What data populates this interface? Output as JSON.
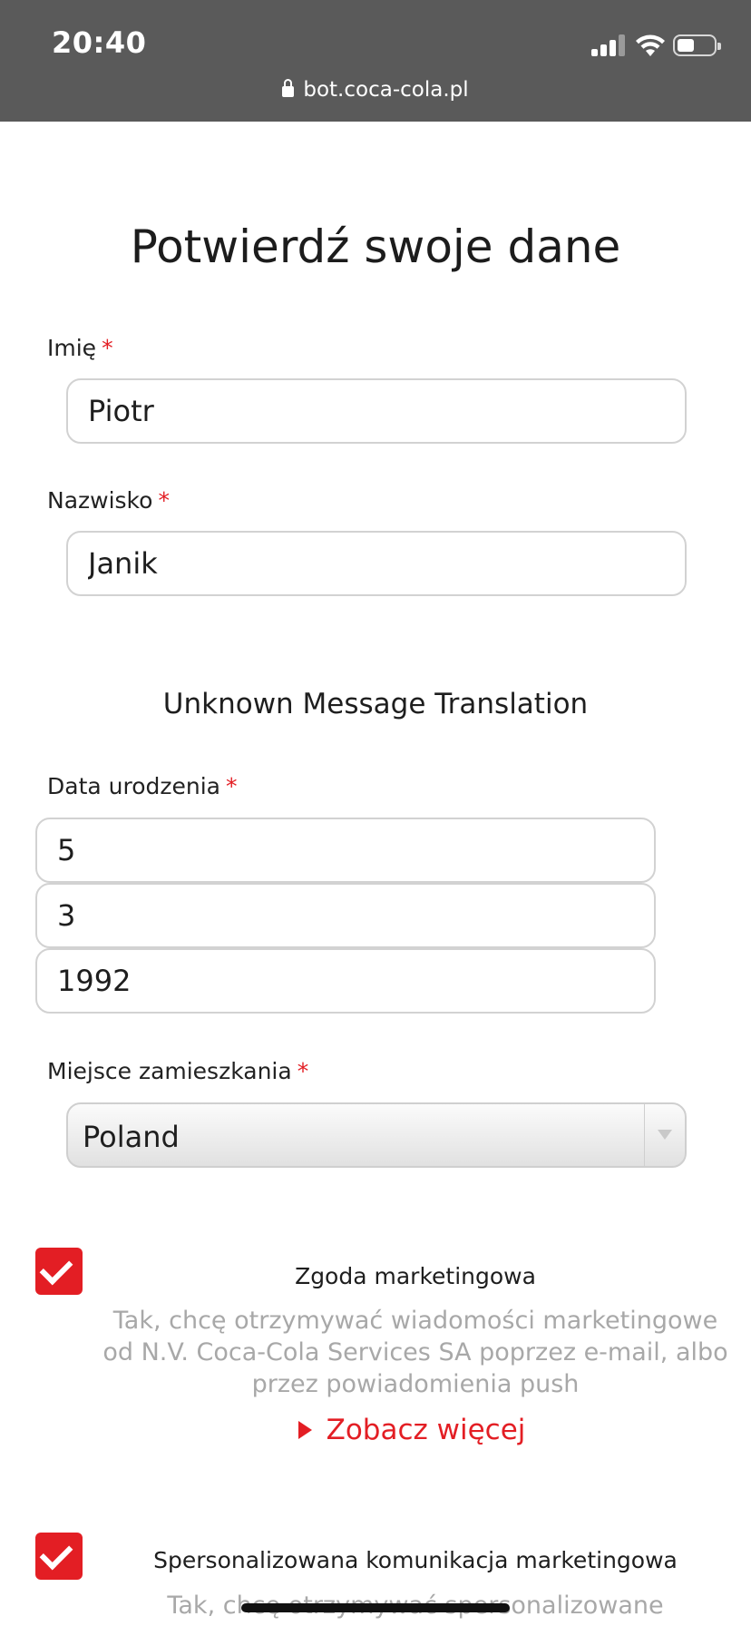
{
  "status_bar": {
    "time": "20:40"
  },
  "browser": {
    "url": "bot.coca-cola.pl"
  },
  "form": {
    "title": "Potwierdź swoje dane",
    "required_mark": "*",
    "first_name": {
      "label": "Imię",
      "value": "Piotr"
    },
    "last_name": {
      "label": "Nazwisko",
      "value": "Janik"
    },
    "section_subtitle": "Unknown Message Translation",
    "birth_date": {
      "label": "Data urodzenia",
      "day": "5",
      "month": "3",
      "year": "1992"
    },
    "residence": {
      "label": "Miejsce zamieszkania",
      "value": "Poland"
    },
    "marketing_consent": {
      "checked": true,
      "title": "Zgoda marketingowa",
      "text": "Tak, chcę otrzymywać wiadomości marketingowe od N.V. Coca-Cola Services SA poprzez e-mail, albo przez powiadomienia push",
      "more_label": "Zobacz więcej"
    },
    "personalized_consent": {
      "checked": true,
      "title": "Spersonalizowana komunikacja marketingowa",
      "text": "Tak, chcę otrzymywać spersonalizowane"
    }
  },
  "colors": {
    "accent": "#e31e24",
    "topbar": "#5a5a5a",
    "muted_text": "#a8a8a8"
  },
  "icons": [
    "lock-icon",
    "signal-icon",
    "wifi-icon",
    "battery-icon",
    "checkmark-icon",
    "chevron-down-icon",
    "play-triangle-icon"
  ]
}
